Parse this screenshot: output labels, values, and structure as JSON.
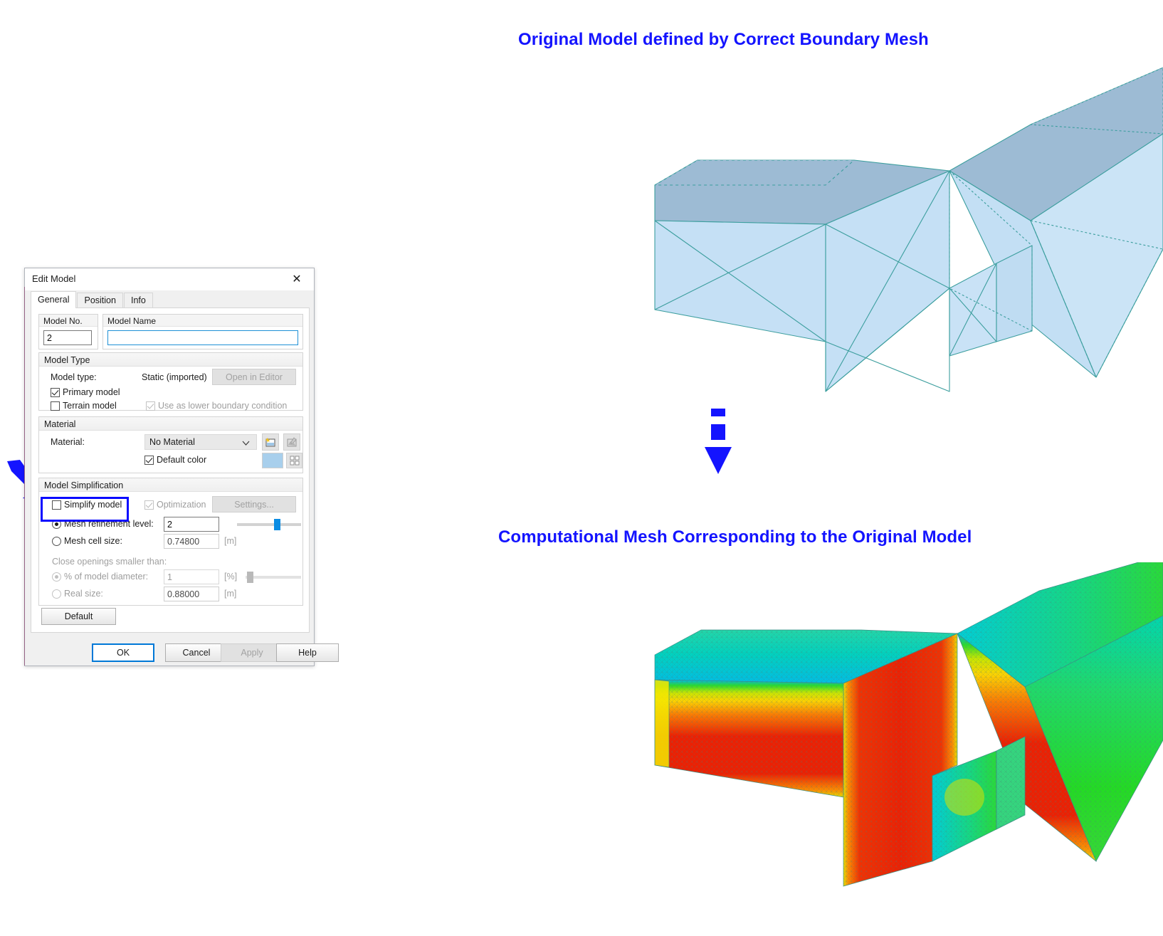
{
  "captions": {
    "top": "Original Model defined by Correct Boundary Mesh",
    "bottom": "Computational Mesh Corresponding to the Original Model",
    "color": "#1414FF"
  },
  "dialog": {
    "title": "Edit Model",
    "close_icon": "close-icon",
    "tabs": [
      {
        "label": "General",
        "active": true
      },
      {
        "label": "Position",
        "active": false
      },
      {
        "label": "Info",
        "active": false
      }
    ],
    "model_no": {
      "label": "Model No.",
      "value": "2"
    },
    "model_name": {
      "label": "Model Name",
      "value": "",
      "placeholder": ""
    },
    "model_type": {
      "group_label": "Model Type",
      "row_label": "Model type:",
      "row_value": "Static (imported)",
      "open_in_editor_button": "Open in Editor",
      "primary_model": {
        "label": "Primary model",
        "checked": true,
        "enabled": true
      },
      "terrain_model": {
        "label": "Terrain model",
        "checked": false,
        "enabled": true
      },
      "lower_boundary": {
        "label": "Use as lower boundary condition",
        "checked": true,
        "enabled": false
      }
    },
    "material": {
      "group_label": "Material",
      "row_label": "Material:",
      "selected": "No Material",
      "options": [
        "No Material"
      ],
      "new_material_icon": "new-material-icon",
      "edit_material_icon": "edit-material-icon",
      "default_color": {
        "label": "Default color",
        "checked": true
      },
      "color_swatch_hex": "#A8CFEC",
      "color_picker_icon": "color-grid-icon"
    },
    "simplification": {
      "group_label": "Model Simplification",
      "simplify_model": {
        "label": "Simplify model",
        "checked": false,
        "highlighted": true
      },
      "optimization": {
        "label": "Optimization",
        "checked": true,
        "enabled": false
      },
      "settings_button": "Settings...",
      "mesh_refinement": {
        "label": "Mesh refinement level:",
        "selected": true,
        "value": "2",
        "slider_percent": 62
      },
      "mesh_cell_size": {
        "label": "Mesh cell size:",
        "selected": false,
        "value": "0.74800",
        "unit": "[m]"
      },
      "close_openings_label": "Close openings smaller than:",
      "percent_of_diameter": {
        "label": "% of model diameter:",
        "selected": true,
        "value": "1",
        "unit": "[%]",
        "slider_percent": 4
      },
      "real_size": {
        "label": "Real size:",
        "selected": false,
        "value": "0.88000",
        "unit": "[m]"
      },
      "default_button": "Default"
    },
    "footer": {
      "ok": "OK",
      "cancel": "Cancel",
      "apply": "Apply",
      "help": "Help",
      "apply_enabled": false
    }
  },
  "annotations": {
    "callout_arrow": "arrow-pointing-to-simplify-model",
    "transition_arrow": "downward-transition-arrow",
    "highlight_color": "#0A0AFF"
  },
  "viewports": {
    "original": {
      "name": "original-boundary-mesh-3d-view",
      "surface_color": "#BEDCF2",
      "top_face_color": "#9DBBD4",
      "edge_color": "#3C9E9E"
    },
    "mesh": {
      "name": "computational-mesh-3d-view",
      "colormap": [
        "#0000C8",
        "#00AEEF",
        "#00D2A0",
        "#2ED52E",
        "#B8E000",
        "#FFE000",
        "#FF8C00",
        "#F01E00"
      ],
      "edge_color": "#4E7E74"
    }
  }
}
